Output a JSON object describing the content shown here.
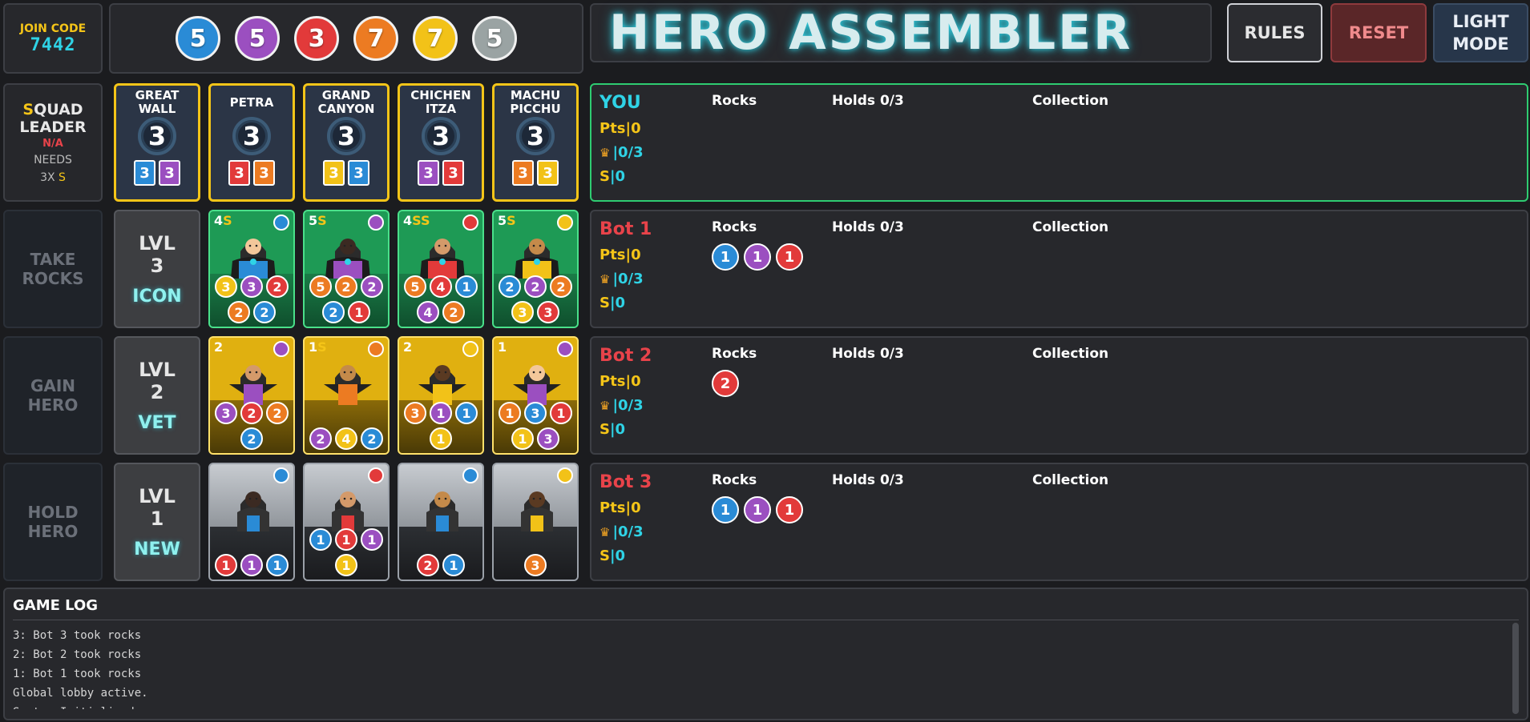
{
  "join": {
    "label": "JOIN CODE",
    "code": "7442"
  },
  "bank": [
    {
      "value": "5",
      "color": "blue"
    },
    {
      "value": "5",
      "color": "purple"
    },
    {
      "value": "3",
      "color": "red"
    },
    {
      "value": "7",
      "color": "orange"
    },
    {
      "value": "7",
      "color": "yellow"
    },
    {
      "value": "5",
      "color": "grey"
    }
  ],
  "title": "HERO ASSEMBLER",
  "buttons": {
    "rules": "RULES",
    "reset": "RESET",
    "light": "LIGHT MODE"
  },
  "squad": {
    "l1": "SQUAD",
    "l2": "LEADER",
    "status": "N/A",
    "needs": "NEEDS",
    "needs2": "3X",
    "s": "S"
  },
  "actions": {
    "take": "TAKE ROCKS",
    "gain": "GAIN HERO",
    "hold": "HOLD HERO"
  },
  "levels": [
    {
      "lvl": "LVL 3",
      "name": "ICON"
    },
    {
      "lvl": "LVL 2",
      "name": "VET"
    },
    {
      "lvl": "LVL 1",
      "name": "NEW"
    }
  ],
  "monuments": [
    {
      "name": "GREAT WALL",
      "pts": "3",
      "req": [
        {
          "v": "3",
          "c": "blue"
        },
        {
          "v": "3",
          "c": "purple"
        }
      ]
    },
    {
      "name": "PETRA",
      "pts": "3",
      "req": [
        {
          "v": "3",
          "c": "red"
        },
        {
          "v": "3",
          "c": "orange"
        }
      ]
    },
    {
      "name": "GRAND CANYON",
      "pts": "3",
      "req": [
        {
          "v": "3",
          "c": "yellow"
        },
        {
          "v": "3",
          "c": "blue"
        }
      ]
    },
    {
      "name": "CHICHEN ITZA",
      "pts": "3",
      "req": [
        {
          "v": "3",
          "c": "purple"
        },
        {
          "v": "3",
          "c": "red"
        }
      ]
    },
    {
      "name": "MACHU PICCHU",
      "pts": "3",
      "req": [
        {
          "v": "3",
          "c": "orange"
        },
        {
          "v": "3",
          "c": "yellow"
        }
      ]
    }
  ],
  "heroes": {
    "l3": [
      {
        "pts": "4",
        "s": "S",
        "gem": "blue",
        "cost": [
          {
            "v": "3",
            "c": "yellow"
          },
          {
            "v": "3",
            "c": "purple"
          },
          {
            "v": "2",
            "c": "red"
          },
          {
            "v": "2",
            "c": "orange"
          },
          {
            "v": "2",
            "c": "blue"
          }
        ]
      },
      {
        "pts": "5",
        "s": "S",
        "gem": "purple",
        "cost": [
          {
            "v": "5",
            "c": "orange"
          },
          {
            "v": "2",
            "c": "orange"
          },
          {
            "v": "2",
            "c": "purple"
          },
          {
            "v": "2",
            "c": "blue"
          },
          {
            "v": "1",
            "c": "red"
          }
        ]
      },
      {
        "pts": "4",
        "s": "SS",
        "gem": "red",
        "cost": [
          {
            "v": "5",
            "c": "orange"
          },
          {
            "v": "4",
            "c": "red"
          },
          {
            "v": "1",
            "c": "blue"
          },
          {
            "v": "4",
            "c": "purple"
          },
          {
            "v": "2",
            "c": "orange"
          }
        ]
      },
      {
        "pts": "5",
        "s": "S",
        "gem": "yellow",
        "cost": [
          {
            "v": "2",
            "c": "blue"
          },
          {
            "v": "2",
            "c": "purple"
          },
          {
            "v": "2",
            "c": "orange"
          },
          {
            "v": "3",
            "c": "yellow"
          },
          {
            "v": "3",
            "c": "red"
          }
        ]
      }
    ],
    "l2": [
      {
        "pts": "2",
        "s": "",
        "gem": "purple",
        "cost": [
          {
            "v": "3",
            "c": "purple"
          },
          {
            "v": "2",
            "c": "red"
          },
          {
            "v": "2",
            "c": "orange"
          },
          {
            "v": "2",
            "c": "blue"
          }
        ]
      },
      {
        "pts": "1",
        "s": "S",
        "gem": "orange",
        "cost": [
          {
            "v": "2",
            "c": "purple"
          },
          {
            "v": "4",
            "c": "yellow"
          },
          {
            "v": "2",
            "c": "blue"
          }
        ]
      },
      {
        "pts": "2",
        "s": "",
        "gem": "yellow",
        "cost": [
          {
            "v": "3",
            "c": "orange"
          },
          {
            "v": "1",
            "c": "purple"
          },
          {
            "v": "1",
            "c": "blue"
          },
          {
            "v": "1",
            "c": "yellow"
          }
        ]
      },
      {
        "pts": "1",
        "s": "",
        "gem": "purple",
        "cost": [
          {
            "v": "1",
            "c": "orange"
          },
          {
            "v": "3",
            "c": "blue"
          },
          {
            "v": "1",
            "c": "red"
          },
          {
            "v": "1",
            "c": "yellow"
          },
          {
            "v": "3",
            "c": "purple"
          }
        ]
      }
    ],
    "l1": [
      {
        "pts": "",
        "s": "",
        "gem": "blue",
        "cost": [
          {
            "v": "1",
            "c": "red"
          },
          {
            "v": "1",
            "c": "purple"
          },
          {
            "v": "1",
            "c": "blue"
          }
        ]
      },
      {
        "pts": "",
        "s": "",
        "gem": "red",
        "cost": [
          {
            "v": "1",
            "c": "blue"
          },
          {
            "v": "1",
            "c": "red"
          },
          {
            "v": "1",
            "c": "purple"
          },
          {
            "v": "1",
            "c": "yellow"
          }
        ]
      },
      {
        "pts": "",
        "s": "",
        "gem": "blue",
        "cost": [
          {
            "v": "2",
            "c": "red"
          },
          {
            "v": "1",
            "c": "blue"
          }
        ]
      },
      {
        "pts": "",
        "s": "",
        "gem": "yellow",
        "cost": [
          {
            "v": "3",
            "c": "orange"
          }
        ]
      }
    ]
  },
  "headers": {
    "rocks": "Rocks",
    "holds": "Holds 0/3",
    "collection": "Collection"
  },
  "players": [
    {
      "name": "YOU",
      "color": "#2fd3e6",
      "pts": "Pts|0",
      "crown": "|0/3",
      "s": "S",
      "sv": "|0",
      "rocks": []
    },
    {
      "name": "Bot 1",
      "color": "#e8434a",
      "pts": "Pts|0",
      "crown": "|0/3",
      "s": "S",
      "sv": "|0",
      "rocks": [
        {
          "v": "1",
          "c": "blue"
        },
        {
          "v": "1",
          "c": "purple"
        },
        {
          "v": "1",
          "c": "red"
        }
      ]
    },
    {
      "name": "Bot 2",
      "color": "#e8434a",
      "pts": "Pts|0",
      "crown": "|0/3",
      "s": "S",
      "sv": "|0",
      "rocks": [
        {
          "v": "2",
          "c": "red"
        }
      ]
    },
    {
      "name": "Bot 3",
      "color": "#e8434a",
      "pts": "Pts|0",
      "crown": "|0/3",
      "s": "S",
      "sv": "|0",
      "rocks": [
        {
          "v": "1",
          "c": "blue"
        },
        {
          "v": "1",
          "c": "purple"
        },
        {
          "v": "1",
          "c": "red"
        }
      ]
    }
  ],
  "log": {
    "title": "GAME LOG",
    "entries": [
      "3: Bot 3 took rocks",
      "2: Bot 2 took rocks",
      "1: Bot 1 took rocks",
      "Global lobby active.",
      "System Initialized"
    ]
  }
}
